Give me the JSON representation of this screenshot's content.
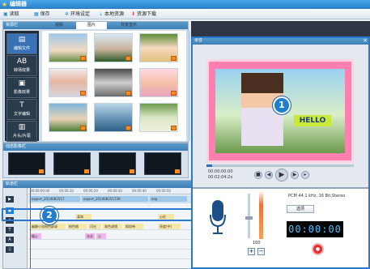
{
  "app": {
    "title": "编辑器"
  },
  "menubar": {
    "items": [
      "读取",
      "保存",
      "环境设定",
      "本地资源",
      "资源下载"
    ]
  },
  "library": {
    "header": "资源栏",
    "tabs": [
      "视频",
      "图片",
      "背景音乐"
    ],
    "active_tab": 1,
    "sidebar": [
      "编辑文件",
      "转场效果",
      "影像效果",
      "文字编辑",
      "片头/片尾"
    ]
  },
  "effects": {
    "header": "动态影像栏"
  },
  "timeline": {
    "header": "轨道栏",
    "ruler": [
      "00:00:00:00",
      "00:00:10",
      "00:00:20",
      "00:00:30",
      "00:00:40",
      "00:00:50",
      "00:01:00",
      "00:01:10",
      "00:01:20",
      "00:01:30",
      "00:01:40",
      "00:01:50",
      "00:02:00"
    ],
    "video_clips": [
      "export_2014082517",
      "export_201408251739",
      "exp"
    ],
    "track2_clips": [
      "柔和",
      "心形"
    ],
    "track3_clips": [
      "幽静小花粉色屏录",
      "粉色格",
      "闪光",
      "渐色滤镜",
      "斜纹带",
      "亮度(中)"
    ],
    "track4_clips": [
      "蝶心",
      "花朵",
      "心"
    ]
  },
  "preview": {
    "header": "录音",
    "close": "×",
    "caption": "HELLO",
    "time_current": "00:00:00:00",
    "time_total": "00:02:04:2x"
  },
  "recorder": {
    "format": "PCM 44.1 kHz, 16 Bit,Stereo",
    "option_label": "选项",
    "volume": "100",
    "clock": "00:00:00",
    "plus": "+",
    "minus": "−"
  },
  "badges": [
    "1",
    "2"
  ],
  "colors": {
    "accent": "#2a78d0",
    "titlebar": "#3b93d8",
    "record": "#e23030"
  }
}
